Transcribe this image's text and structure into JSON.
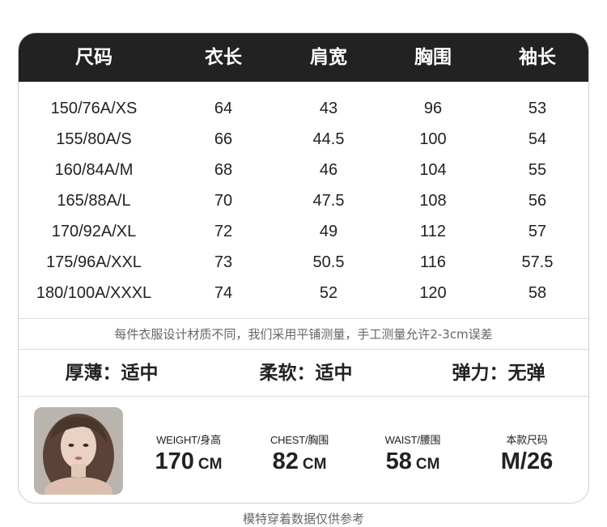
{
  "table": {
    "headers": [
      "尺码",
      "衣长",
      "肩宽",
      "胸围",
      "袖长"
    ],
    "rows": [
      [
        "150/76A/XS",
        "64",
        "43",
        "96",
        "53"
      ],
      [
        "155/80A/S",
        "66",
        "44.5",
        "100",
        "54"
      ],
      [
        "160/84A/M",
        "68",
        "46",
        "104",
        "55"
      ],
      [
        "165/88A/L",
        "70",
        "47.5",
        "108",
        "56"
      ],
      [
        "170/92A/XL",
        "72",
        "49",
        "112",
        "57"
      ],
      [
        "175/96A/XXL",
        "73",
        "50.5",
        "116",
        "57.5"
      ],
      [
        "180/100A/XXXL",
        "74",
        "52",
        "120",
        "58"
      ]
    ]
  },
  "note": "每件衣服设计材质不同，我们采用平铺测量，手工测量允许2-3cm误差",
  "properties": [
    "厚薄：适中",
    "柔软：适中",
    "弹力：无弹"
  ],
  "model": {
    "stats": [
      {
        "label": "WEIGHT/身高",
        "value": "170",
        "unit": "CM"
      },
      {
        "label": "CHEST/胸围",
        "value": "82",
        "unit": "CM"
      },
      {
        "label": "WAIST/腰围",
        "value": "58",
        "unit": "CM"
      },
      {
        "label": "本款尺码",
        "value": "M/26",
        "unit": ""
      }
    ]
  },
  "footer": "模特穿着数据仅供参考",
  "colors": {
    "header_bg": "#222222",
    "header_text": "#ffffff",
    "text": "#222222",
    "muted": "#666666",
    "border": "#cfcfcf"
  }
}
